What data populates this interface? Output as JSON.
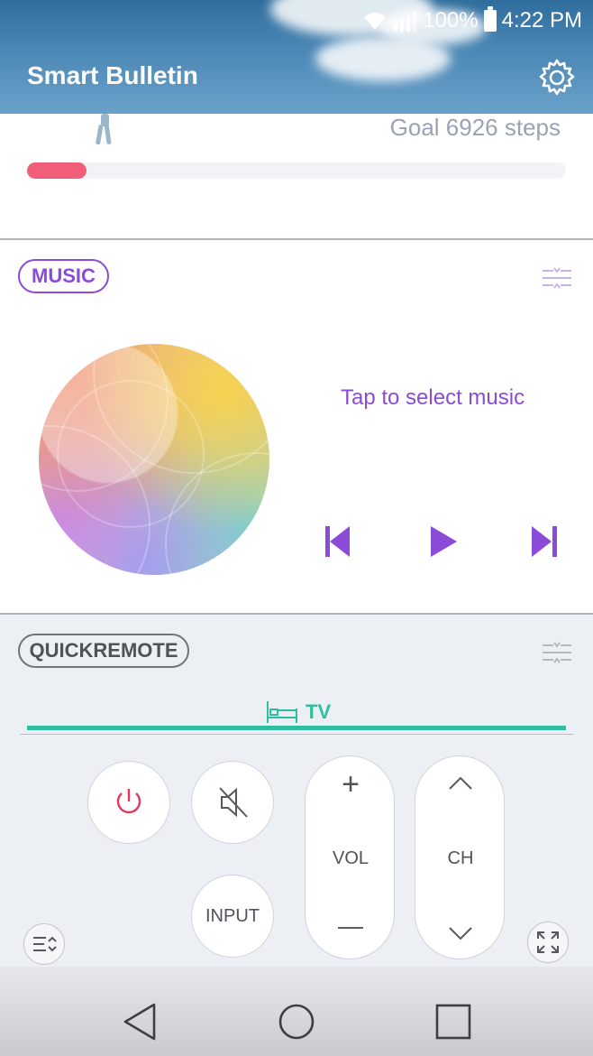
{
  "status_bar": {
    "battery_percent": "100%",
    "time": "4:22 PM",
    "icons": [
      "wifi-icon",
      "signal-icon",
      "battery-icon"
    ]
  },
  "header": {
    "title": "Smart Bulletin",
    "settings_icon": "gear-icon"
  },
  "steps_widget": {
    "goal_text": "Goal 6926 steps",
    "progress_fraction": 0.11,
    "icon": "walker-icon"
  },
  "music_widget": {
    "label": "MUSIC",
    "prompt": "Tap to select music",
    "controls": [
      "previous-icon",
      "play-icon",
      "next-icon"
    ],
    "menu_icon": "collapse-menu-icon"
  },
  "quickremote_widget": {
    "label": "QUICKREMOTE",
    "tab_label": "TV",
    "tab_icon": "bed-icon",
    "buttons": {
      "power_icon": "power-icon",
      "mute_icon": "mute-icon",
      "input": "INPUT",
      "volume": "VOL",
      "channel": "CH",
      "plus": "+",
      "minus": "—"
    },
    "menu_icon": "collapse-menu-icon"
  },
  "nav_bar": {
    "items": [
      "back-icon",
      "home-icon",
      "recents-icon"
    ]
  },
  "colors": {
    "music_accent": "#8b4bd8",
    "remote_accent": "#2fbfa0",
    "steps_fill": "#f15e7a"
  }
}
